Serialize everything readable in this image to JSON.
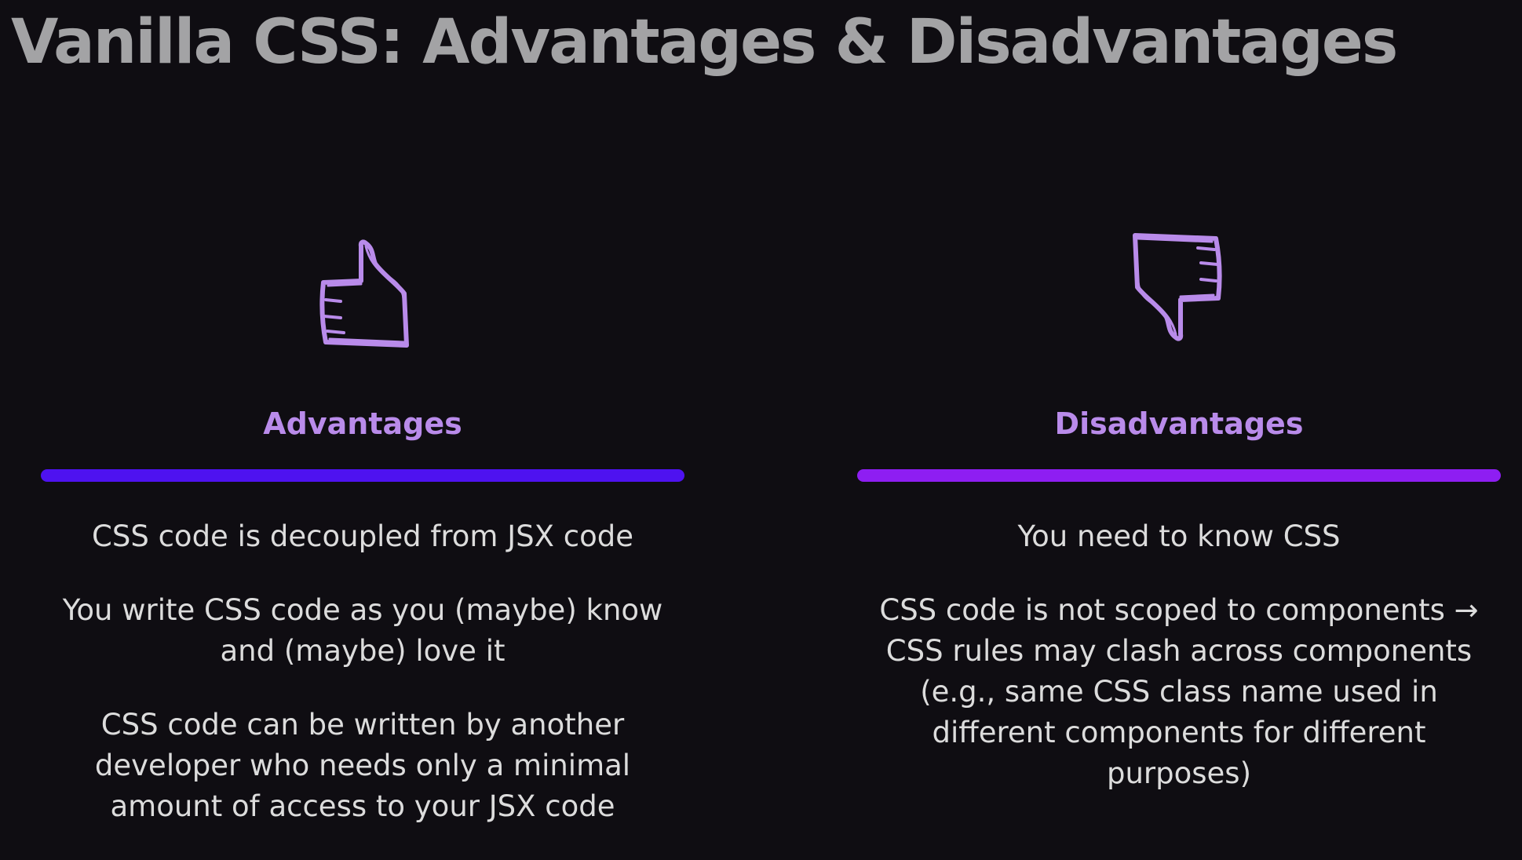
{
  "slide": {
    "title": "Vanilla CSS: Advantages & Disadvantages"
  },
  "colors": {
    "background": "#0f0d12",
    "title": "#a3a3a5",
    "heading": "#b98bea",
    "icon_stroke": "#b98bea",
    "advantages_bar": "#4e12f0",
    "disadvantages_bar": "#8e1ef2",
    "body_text": "#dcdcdc"
  },
  "advantages": {
    "icon": "thumbs-up-icon",
    "heading": "Advantages",
    "points": [
      {
        "lines": [
          "CSS code is decoupled from JSX code"
        ]
      },
      {
        "lines": [
          "You write CSS code as you (maybe) know",
          "and (maybe) love it"
        ]
      },
      {
        "lines": [
          "CSS code can be written by another",
          "developer who needs only a minimal",
          "amount of access to your JSX code"
        ]
      }
    ]
  },
  "disadvantages": {
    "icon": "thumbs-down-icon",
    "heading": "Disadvantages",
    "points": [
      {
        "lines": [
          "You need to know CSS"
        ]
      },
      {
        "lines": [
          "CSS code is not scoped to components →",
          "CSS rules may clash across components",
          "(e.g., same CSS class name used in",
          "different components for different",
          "purposes)"
        ]
      }
    ]
  }
}
